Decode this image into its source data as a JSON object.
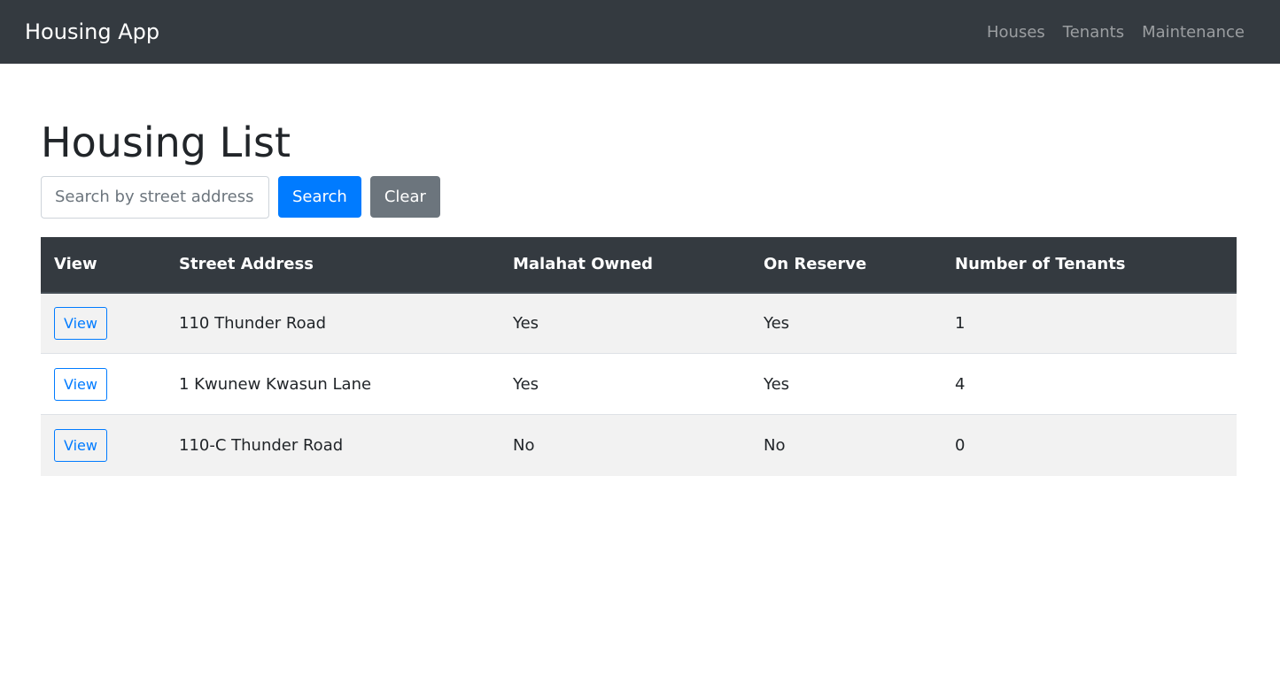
{
  "navbar": {
    "brand": "Housing App",
    "links": [
      "Houses",
      "Tenants",
      "Maintenance"
    ]
  },
  "page": {
    "title": "Housing List"
  },
  "search": {
    "placeholder": "Search by street address",
    "value": "",
    "search_label": "Search",
    "clear_label": "Clear"
  },
  "table": {
    "headers": [
      "View",
      "Street Address",
      "Malahat Owned",
      "On Reserve",
      "Number of Tenants"
    ],
    "rows": [
      {
        "view": "View",
        "address": "110 Thunder Road",
        "owned": "Yes",
        "reserve": "Yes",
        "tenants": "1"
      },
      {
        "view": "View",
        "address": "1 Kwunew Kwasun Lane",
        "owned": "Yes",
        "reserve": "Yes",
        "tenants": "4"
      },
      {
        "view": "View",
        "address": "110-C Thunder Road",
        "owned": "No",
        "reserve": "No",
        "tenants": "0"
      }
    ]
  },
  "colors": {
    "navbar_bg": "#343a40",
    "primary": "#007bff",
    "secondary": "#6c757d",
    "stripe": "#f2f2f2"
  }
}
